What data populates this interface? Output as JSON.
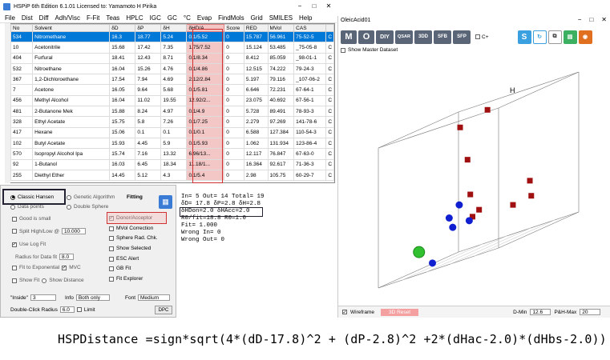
{
  "window_title": "HSPiP 6th Edition 6.1.01 Licensed to: Yamamoto H Pirika",
  "menu": [
    "File",
    "Dist",
    "Diff",
    "Adh/Visc",
    "F-Fit",
    "Teas",
    "HPLC",
    "IGC",
    "GC",
    "°C",
    "Evap",
    "FindMols",
    "Grid",
    "SMILES",
    "Help"
  ],
  "table": {
    "headers": [
      "No",
      "Solvent",
      "δD",
      "δP",
      "δH",
      "δHD/A",
      "Score",
      "RED",
      "MVol",
      "CAS",
      ""
    ],
    "rows": [
      [
        "534",
        "Nitromethane",
        "16.3",
        "18.77",
        "5.24",
        "0.1/5.52",
        "0",
        "15.787",
        "56.961",
        "75-52-5",
        "C"
      ],
      [
        "10",
        "Acetonitrile",
        "15.68",
        "17.42",
        "7.35",
        "1.75/7.52",
        "0",
        "15.124",
        "53.485",
        "_75-05-8",
        "C"
      ],
      [
        "404",
        "Furfural",
        "18.41",
        "12.43",
        "8.71",
        "0.1/8.34",
        "0",
        "8.412",
        "85.059",
        "_98-01-1",
        "C"
      ],
      [
        "532",
        "Nitroethane",
        "16.04",
        "15.26",
        "4.76",
        "0.1/4.86",
        "0",
        "12.515",
        "74.222",
        "79-24-3",
        "C"
      ],
      [
        "367",
        "1,2-Dichloroethane",
        "17.54",
        "7.94",
        "4.69",
        "2.12/2.84",
        "0",
        "5.197",
        "79.116",
        "_107-06-2",
        "C"
      ],
      [
        "7",
        "Acetone",
        "16.05",
        "9.64",
        "5.68",
        "0.1/5.81",
        "0",
        "6.646",
        "72.231",
        "67-64-1",
        "C"
      ],
      [
        "456",
        "Methyl Alcohol",
        "16.04",
        "11.02",
        "19.55",
        "12.92/2...",
        "0",
        "23.075",
        "40.692",
        "67-56-1",
        "C"
      ],
      [
        "481",
        "2-Butanone Mek",
        "15.88",
        "8.24",
        "4.97",
        "0.1/4.9",
        "0",
        "5.728",
        "89.491",
        "78-93-3",
        "C"
      ],
      [
        "328",
        "Ethyl Acetate",
        "15.75",
        "5.8",
        "7.26",
        "0.1/7.25",
        "0",
        "2.279",
        "97.269",
        "141-78-6",
        "C"
      ],
      [
        "417",
        "Hexane",
        "15.06",
        "0.1",
        "0.1",
        "0.1/0.1",
        "0",
        "6.588",
        "127.384",
        "110-54-3",
        "C"
      ],
      [
        "102",
        "Butyl Acetate",
        "15.93",
        "4.45",
        "5.9",
        "0.1/5.93",
        "0",
        "1.062",
        "131.934",
        "123-86-4",
        "C"
      ],
      [
        "570",
        "Isopropyl Alcohol Ipa",
        "15.74",
        "7.16",
        "13.32",
        "6.96/13...",
        "0",
        "12.117",
        "76.847",
        "67-63-0",
        "C"
      ],
      [
        "92",
        "1-Butanol",
        "16.03",
        "6.45",
        "18.34",
        "11.18/1...",
        "0",
        "16.364",
        "92.617",
        "71-36-3",
        "C"
      ],
      [
        "255",
        "Diethyl Ether",
        "14.45",
        "5.12",
        "4.3",
        "0.1/5.4",
        "0",
        "2.98",
        "105.75",
        "60-29-7",
        "C"
      ]
    ]
  },
  "left_panel": {
    "classic_hansen": "Classic Hansen",
    "genetic_algorithm": "Genetic Algorithm",
    "fitting_label": "Fitting",
    "data_points": "Data points",
    "double_sphere": "Double Sphere",
    "good_is_small": "Good is small",
    "split_high_low": "Split High/Low @",
    "split_value": "10.000",
    "use_log_fit": "Use Log Fit",
    "radius_for_data_fit": "Radius for Data fit",
    "radius_value": "8.0",
    "fit_to_exponential": "Fit to Exponential",
    "mvc": "MVC",
    "show_fit": "Show Fit",
    "show_distance": "Show Distance",
    "donor_acceptor": "Donor/Acceptor",
    "mvol_correction": "MVol Correction",
    "sphere_rad_chk": "Sphere Rad. Chk.",
    "show_selected": "Show Selected",
    "esc_alert": "ESC Alert",
    "gb_fit": "GB Fit",
    "fit_explorer": "Fit Explorer",
    "inside_label": "\"Inside\"",
    "inside_value": "3",
    "info_label": "Info",
    "info_value": "Both only",
    "font_label": "Font",
    "font_value": "Medium",
    "double_click_radius": "Double-Click Radius",
    "dcr_value": "6.0",
    "limit": "Limit",
    "dpc_button": "DPC"
  },
  "output_lines": [
    "In= 5 Out= 14 Total= 19",
    "δD= 17.8 δP=2.8 δH=2.8",
    "δHDon=2.0 δHAcc=2.0",
    "R0/fit=18.8 R0=1.0",
    "Fit= 1.000",
    "Wrong In= 0",
    "Wrong Out= 0"
  ],
  "right_panel": {
    "title": "OleicAcid01",
    "buttons": [
      "M",
      "O",
      "DIY",
      "QSAR",
      "3DD",
      "SFB",
      "SFP"
    ],
    "c_label": "C+",
    "show_master": "Show Master Dataset",
    "axis_h": "H",
    "wireframe": "Wireframe",
    "reset_3d": "3D Reset",
    "dmin_label": "D-Min",
    "dmin_value": "12.6",
    "phmax_label": "P&H-Max",
    "phmax_value": "20"
  },
  "formula": "HSPDistance =sign*sqrt(4*(dD-17.8)^2 + (dP-2.8)^2 +2*(dHac-2.0)*(dHbs-2.0))",
  "colors": {
    "highlight": "#f4c7c7",
    "red_outline": "#d03030",
    "selected_row": "#0078d7",
    "red_point": "#a01010",
    "blue_point": "#1020d0",
    "green_sphere": "#30c030"
  },
  "chart_data": {
    "type": "scatter",
    "title": "",
    "xlabel": "",
    "ylabel": "H",
    "inside_points": [
      [
        17.54,
        7.94,
        4.69
      ],
      [
        15.93,
        4.45,
        5.9
      ],
      [
        15.75,
        5.8,
        7.26
      ],
      [
        14.45,
        5.12,
        4.3
      ],
      [
        15.06,
        0.1,
        0.1
      ]
    ],
    "outside_points": [
      [
        16.3,
        18.77,
        5.24
      ],
      [
        15.68,
        17.42,
        7.35
      ],
      [
        18.41,
        12.43,
        8.71
      ],
      [
        16.04,
        15.26,
        4.76
      ],
      [
        16.05,
        9.64,
        5.68
      ],
      [
        16.04,
        11.02,
        19.55
      ],
      [
        15.88,
        8.24,
        4.97
      ],
      [
        15.74,
        7.16,
        13.32
      ],
      [
        16.03,
        6.45,
        18.34
      ]
    ],
    "center": [
      17.8,
      2.8,
      2.8
    ]
  }
}
